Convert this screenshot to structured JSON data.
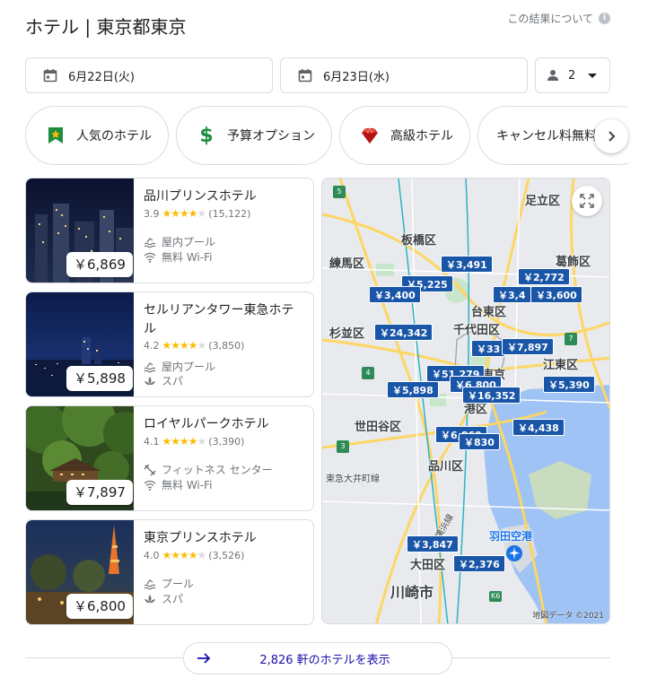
{
  "header": {
    "title": "ホテル | 東京都東京",
    "about": "この結果について"
  },
  "search": {
    "checkin": "6月22日(火)",
    "checkout": "6月23日(水)",
    "guests": "2"
  },
  "chips": [
    {
      "label": "人気のホテル",
      "icon": "trophy-icon",
      "color": "#1e8e3e"
    },
    {
      "label": "予算オプション",
      "icon": "dollar-icon",
      "color": "#1e8e3e"
    },
    {
      "label": "高級ホテル",
      "icon": "gem-icon",
      "color": "#d93025"
    },
    {
      "label": "キャンセル料無料",
      "icon": "none"
    }
  ],
  "hotels": [
    {
      "name": "品川プリンスホテル",
      "rating": "3.9",
      "stars": 4,
      "reviews": "(15,122)",
      "price": "￥6,869",
      "amenities": [
        "屋内プール",
        "無料 Wi-Fi"
      ]
    },
    {
      "name": "セルリアンタワー東急ホテル",
      "rating": "4.2",
      "stars": 4,
      "reviews": "(3,850)",
      "price": "￥5,898",
      "amenities": [
        "屋内プール",
        "スパ"
      ]
    },
    {
      "name": "ロイヤルパークホテル",
      "rating": "4.1",
      "stars": 4,
      "reviews": "(3,390)",
      "price": "￥7,897",
      "amenities": [
        "フィットネス センター",
        "無料 Wi-Fi"
      ]
    },
    {
      "name": "東京プリンスホテル",
      "rating": "4.0",
      "stars": 4,
      "reviews": "(3,526)",
      "price": "￥6,800",
      "amenities": [
        "プール",
        "スパ"
      ]
    }
  ],
  "map": {
    "labels": [
      "足立区",
      "板橋区",
      "葛飾区",
      "練馬区",
      "台東区",
      "千代田区",
      "杉並区",
      "東京",
      "江東区",
      "世田谷区",
      "港区",
      "品川区",
      "大田区",
      "川崎市",
      "羽田空港",
      "東急大井町線",
      "横浜線"
    ],
    "pins": [
      "￥3,491",
      "￥5,225",
      "￥3,400",
      "￥2,772",
      "￥3,4",
      "￥3,600",
      "￥24,342",
      "￥33",
      "￥7,897",
      "￥51,279",
      "￥6,800",
      "￥5,898",
      "￥16,352",
      "￥5,390",
      "￥4,438",
      "￥6,869",
      "￥830",
      "￥3,847",
      "￥2,376"
    ],
    "credit": "地図データ ©2021",
    "road_numbers": [
      "5",
      "4",
      "3",
      "7",
      "K6"
    ]
  },
  "footer": {
    "more": "2,826 軒のホテルを表示"
  }
}
